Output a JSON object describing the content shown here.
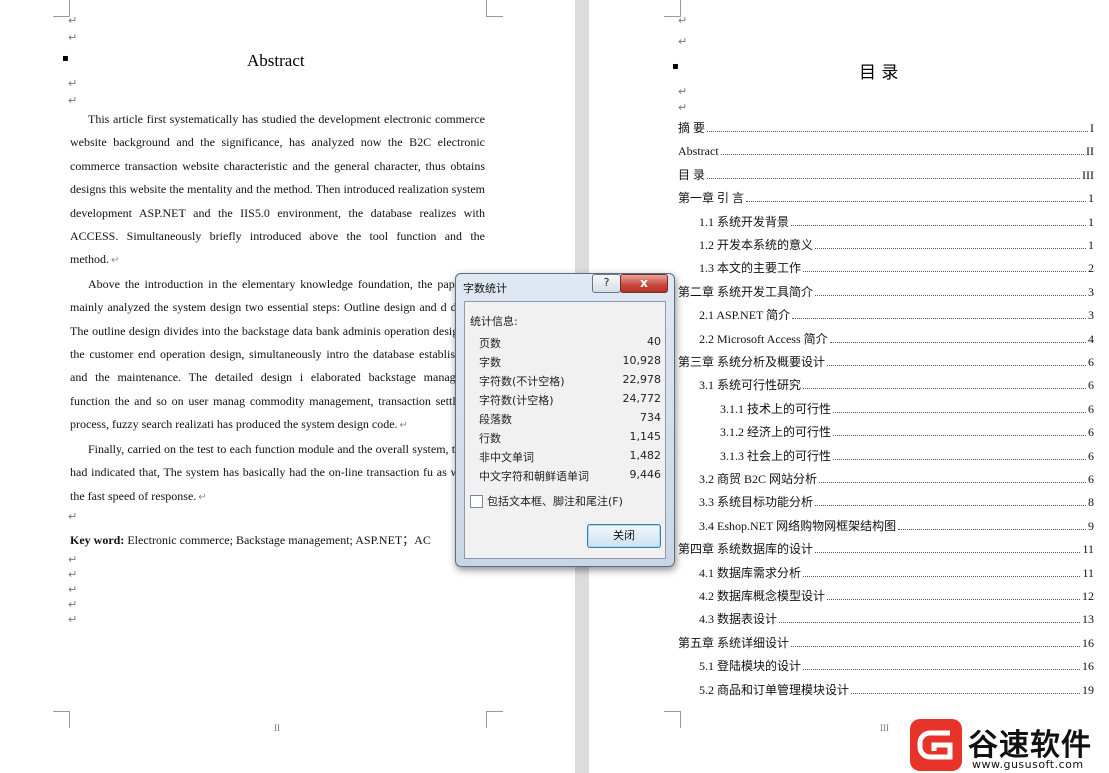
{
  "left_page": {
    "title": "Abstract",
    "paragraphs": [
      "This article first systematically has studied the development electronic commerce website background and the significance, has analyzed now the B2C electronic commerce transaction website characteristic and the general character, thus obtains designs this website the mentality and the method. Then introduced realization system development ASP.NET and the IIS5.0 environment, the database realizes with ACCESS. Simultaneously briefly introduced above the tool function and the method.",
      "Above the introduction in the elementary knowledge foundation, the paper has mainly analyzed the system design two essential steps: Outline design and d design. The outline design divides into the backstage data bank adminis operation design and the customer end operation design, simultaneously intro the database establishment and the maintenance. The detailed design i elaborated backstage management function the and so on user manag commodity management, transaction settlement process, fuzzy search realizati has produced the system design code.",
      "Finally, carried on the test to each function module and the overall system, t result had indicated that, The system has basically had the on-line transaction fu as well as the fast speed of response."
    ],
    "keyword_label": "Key word:",
    "keywords": "Electronic commerce;   Backstage management;   ASP.NET；AC",
    "folio": "II",
    "return_mark": "↵"
  },
  "right_page": {
    "title": "目  录",
    "folio": "III",
    "toc": [
      {
        "label": "摘  要",
        "page": "I",
        "level": 0
      },
      {
        "label": "Abstract",
        "page": "II",
        "level": 0
      },
      {
        "label": "目  录",
        "page": "III",
        "level": 0
      },
      {
        "label": "第一章  引  言",
        "page": "1",
        "level": 0
      },
      {
        "label": "1.1  系统开发背景",
        "page": "1",
        "level": 1
      },
      {
        "label": "1.2  开发本系统的意义",
        "page": "1",
        "level": 1
      },
      {
        "label": "1.3  本文的主要工作",
        "page": "2",
        "level": 1
      },
      {
        "label": "第二章  系统开发工具简介",
        "page": "3",
        "level": 0
      },
      {
        "label": "2.1  ASP.NET 简介",
        "page": "3",
        "level": 1
      },
      {
        "label": "2.2  Microsoft Access 简介",
        "page": "4",
        "level": 1
      },
      {
        "label": "第三章  系统分析及概要设计",
        "page": "6",
        "level": 0
      },
      {
        "label": "3.1  系统可行性研究",
        "page": "6",
        "level": 1
      },
      {
        "label": "3.1.1  技术上的可行性",
        "page": "6",
        "level": 2
      },
      {
        "label": "3.1.2  经济上的可行性",
        "page": "6",
        "level": 2
      },
      {
        "label": "3.1.3  社会上的可行性",
        "page": "6",
        "level": 2
      },
      {
        "label": "3.2  商贸 B2C 网站分析",
        "page": "6",
        "level": 1
      },
      {
        "label": "3.3  系统目标功能分析",
        "page": "8",
        "level": 1
      },
      {
        "label": "3.4  Eshop.NET 网络购物网框架结构图",
        "page": "9",
        "level": 1
      },
      {
        "label": "第四章  系统数据库的设计",
        "page": "11",
        "level": 0
      },
      {
        "label": "4.1  数据库需求分析",
        "page": "11",
        "level": 1
      },
      {
        "label": "4.2  数据库概念模型设计",
        "page": "12",
        "level": 1
      },
      {
        "label": "4.3  数据表设计",
        "page": "13",
        "level": 1
      },
      {
        "label": "第五章  系统详细设计",
        "page": "16",
        "level": 0
      },
      {
        "label": "5.1  登陆模块的设计",
        "page": "16",
        "level": 1
      },
      {
        "label": "5.2  商品和订单管理模块设计",
        "page": "19",
        "level": 1
      }
    ]
  },
  "dialog": {
    "title": "字数统计",
    "help_label": "?",
    "close_x": "x",
    "stats_heading": "统计信息:",
    "stats": [
      {
        "label": "页数",
        "value": "40"
      },
      {
        "label": "字数",
        "value": "10,928"
      },
      {
        "label": "字符数(不计空格)",
        "value": "22,978"
      },
      {
        "label": "字符数(计空格)",
        "value": "24,772"
      },
      {
        "label": "段落数",
        "value": "734"
      },
      {
        "label": "行数",
        "value": "1,145"
      },
      {
        "label": "非中文单词",
        "value": "1,482"
      },
      {
        "label": "中文字符和朝鲜语单词",
        "value": "9,446"
      }
    ],
    "checkbox_label": "包括文本框、脚注和尾注(F)",
    "checkbox_checked": false,
    "close_button": "关闭"
  },
  "watermark": {
    "name": "谷速软件",
    "url": "www.gususoft.com",
    "color": "#e8332a"
  }
}
